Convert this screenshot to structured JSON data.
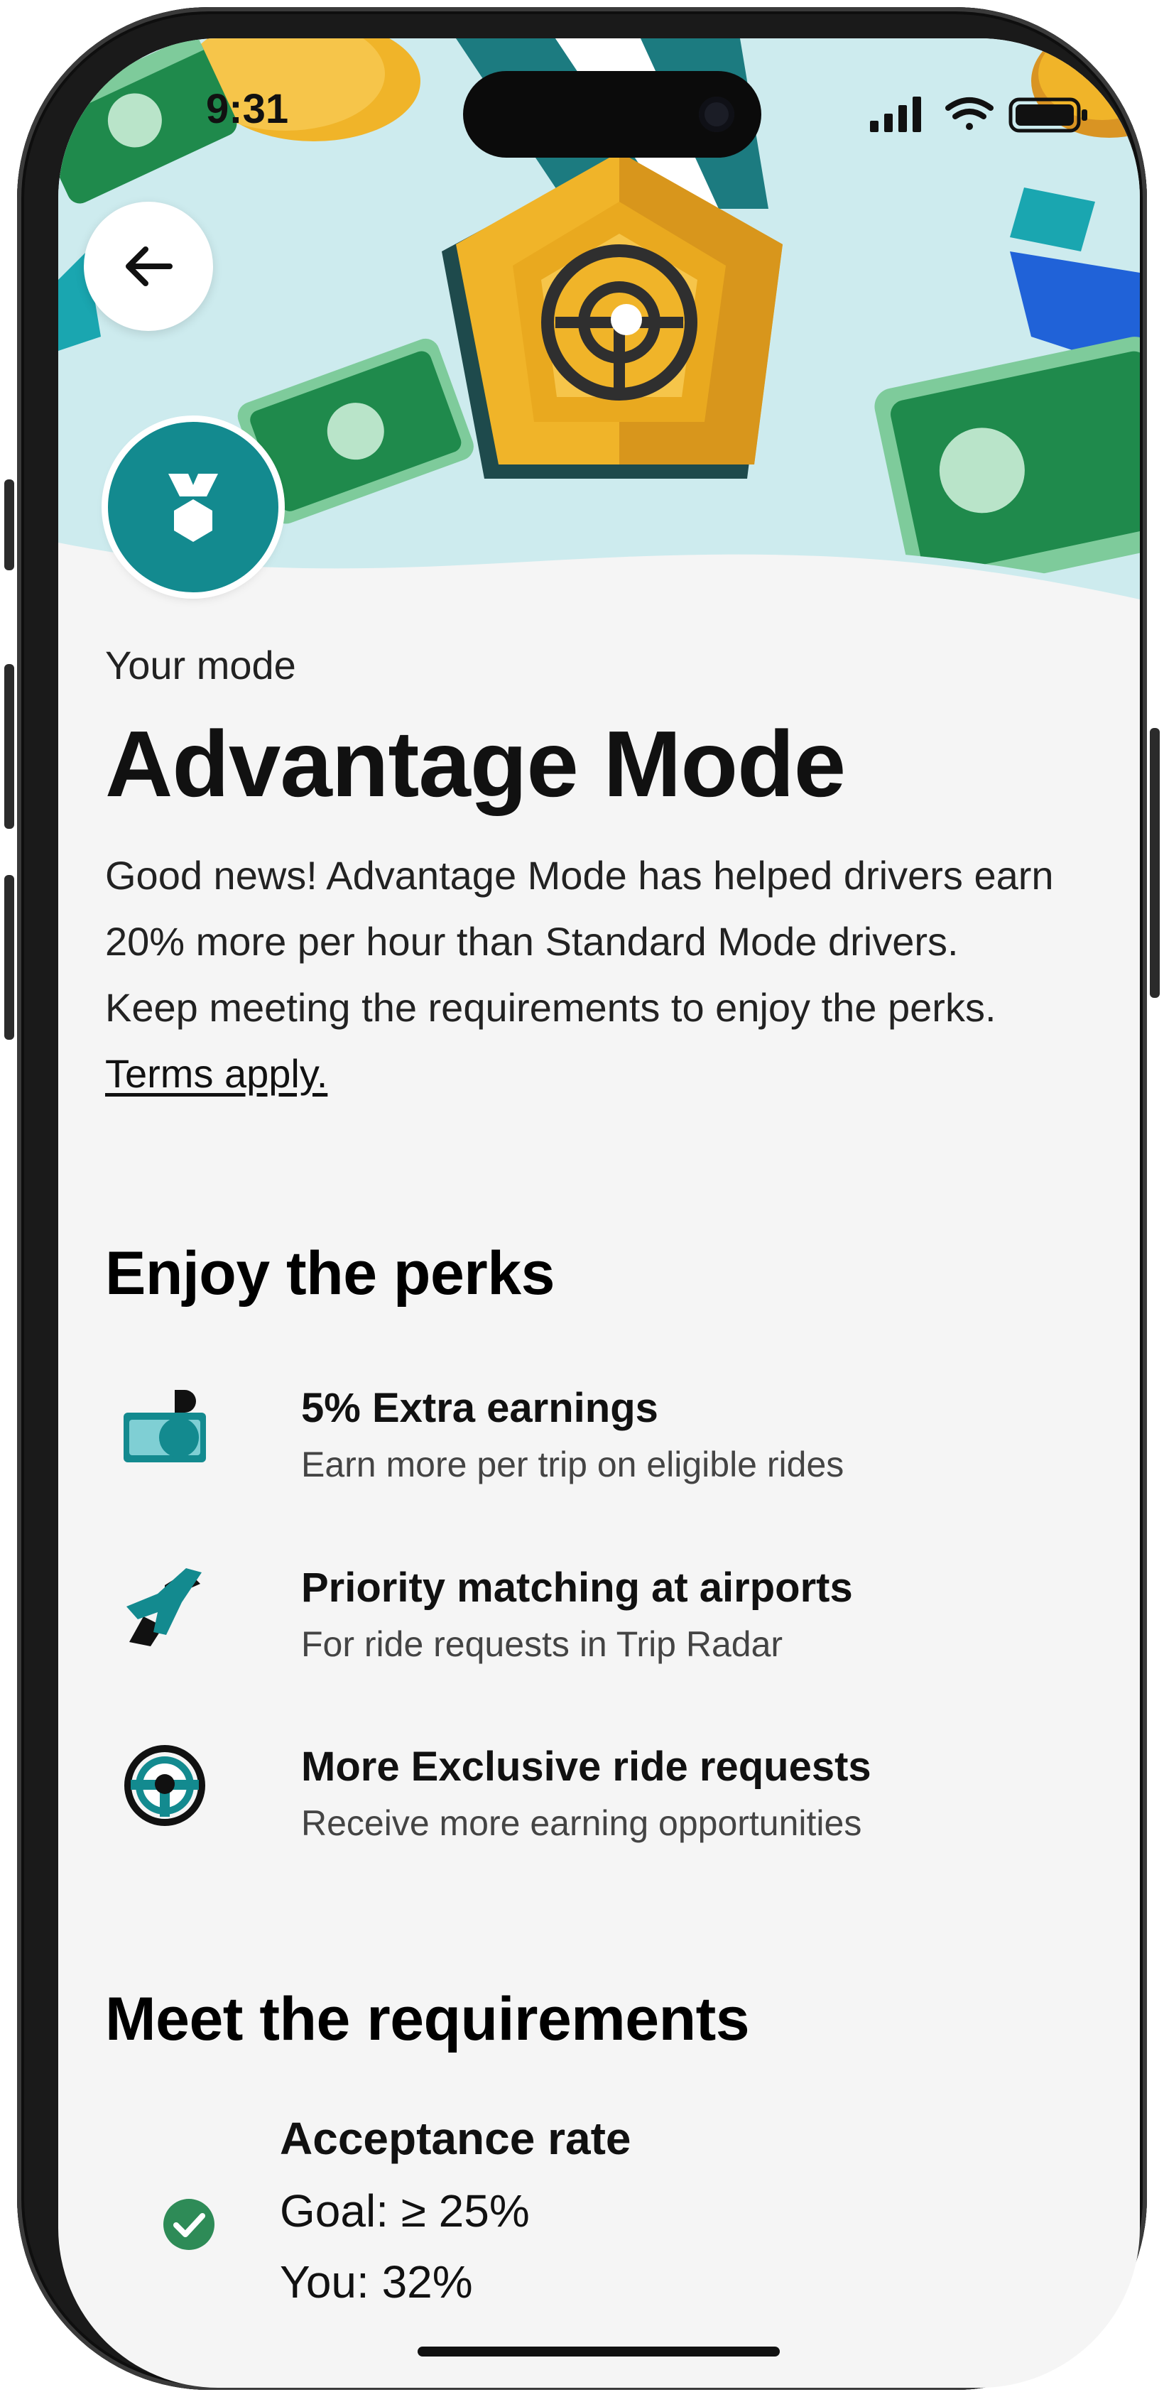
{
  "status_bar": {
    "time": "9:31"
  },
  "header": {
    "back_icon": "arrow-left-icon",
    "badge_icon": "medal-icon"
  },
  "intro": {
    "eyebrow": "Your mode",
    "title": "Advantage Mode",
    "description": "Good news! Advantage Mode has helped drivers earn 20% more per hour than Standard Mode drivers. Keep meeting the requirements to enjoy the perks.",
    "terms_link": "Terms apply."
  },
  "perks": {
    "heading": "Enjoy the perks",
    "items": [
      {
        "icon": "cash-icon",
        "title": "5% Extra earnings",
        "subtitle": "Earn more per trip on eligible rides"
      },
      {
        "icon": "airplane-icon",
        "title": "Priority matching at airports",
        "subtitle": "For ride requests in Trip Radar"
      },
      {
        "icon": "steering-wheel-icon",
        "title": "More Exclusive ride requests",
        "subtitle": "Receive more earning opportunities"
      }
    ]
  },
  "requirements": {
    "heading": "Meet the requirements",
    "items": [
      {
        "icon": "check-circle-icon",
        "title": "Acceptance rate",
        "goal": "Goal: ≥ 25%",
        "you": "You: 32%"
      }
    ]
  },
  "colors": {
    "accent_teal": "#138a8f",
    "medal_gold": "#f0b429",
    "cash_green": "#1f8a4c",
    "hero_bg": "#cdebee",
    "success_green": "#2e8b57"
  }
}
